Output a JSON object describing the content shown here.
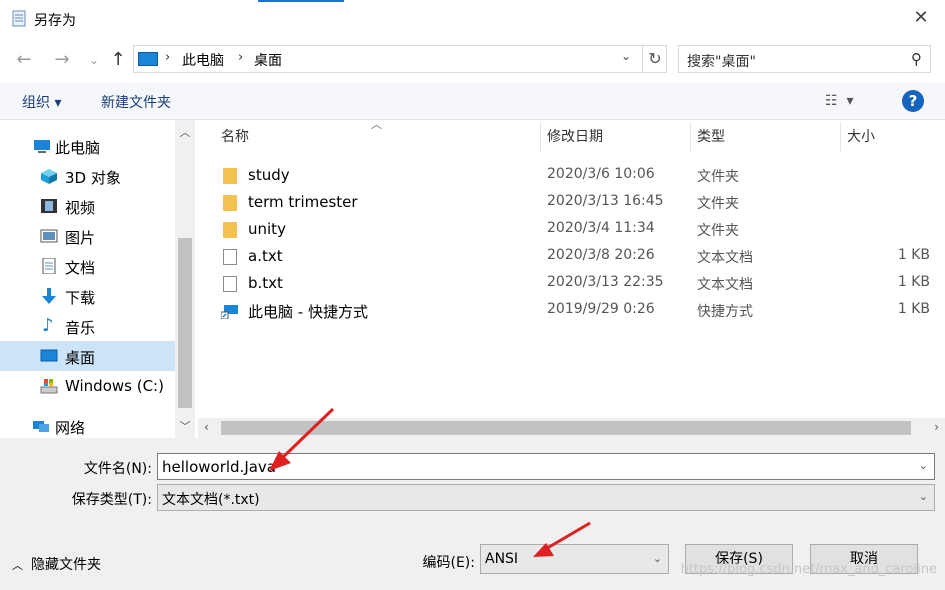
{
  "window": {
    "title": "另存为",
    "close_label": "✕"
  },
  "nav": {
    "back_icon": "←",
    "forward_icon": "→",
    "recent_icon": "⌄",
    "up_icon": "↑",
    "breadcrumb": [
      "此电脑",
      "桌面"
    ],
    "search_placeholder": "搜索\"桌面\""
  },
  "toolbar": {
    "organize": "组织 ▾",
    "new_folder": "新建文件夹",
    "help": "?"
  },
  "sidebar": {
    "items": [
      {
        "label": "此电脑",
        "icon": "computer-icon"
      },
      {
        "label": "3D 对象",
        "icon": "cube-icon"
      },
      {
        "label": "视频",
        "icon": "video-icon"
      },
      {
        "label": "图片",
        "icon": "picture-icon"
      },
      {
        "label": "文档",
        "icon": "document-icon"
      },
      {
        "label": "下载",
        "icon": "download-icon"
      },
      {
        "label": "音乐",
        "icon": "music-icon"
      },
      {
        "label": "桌面",
        "icon": "desktop-icon",
        "selected": true
      },
      {
        "label": "Windows (C:)",
        "icon": "drive-icon"
      },
      {
        "label": "网络",
        "icon": "network-icon"
      }
    ]
  },
  "list": {
    "columns": [
      "名称",
      "修改日期",
      "类型",
      "大小"
    ],
    "rows": [
      {
        "name": "study",
        "date": "2020/3/6 10:06",
        "type": "文件夹",
        "size": "",
        "icon": "folder-icon"
      },
      {
        "name": "term trimester",
        "date": "2020/3/13 16:45",
        "type": "文件夹",
        "size": "",
        "icon": "folder-icon"
      },
      {
        "name": "unity",
        "date": "2020/3/4 11:34",
        "type": "文件夹",
        "size": "",
        "icon": "folder-icon"
      },
      {
        "name": "a.txt",
        "date": "2020/3/8 20:26",
        "type": "文本文档",
        "size": "1 KB",
        "icon": "text-file-icon"
      },
      {
        "name": "b.txt",
        "date": "2020/3/13 22:35",
        "type": "文本文档",
        "size": "1 KB",
        "icon": "text-file-icon"
      },
      {
        "name": "此电脑 - 快捷方式",
        "date": "2019/9/29 0:26",
        "type": "快捷方式",
        "size": "1 KB",
        "icon": "shortcut-icon"
      }
    ]
  },
  "form": {
    "filename_label": "文件名(N):",
    "filename_value": "helloworld.Java",
    "filetype_label": "保存类型(T):",
    "filetype_value": "文本文档(*.txt)",
    "encoding_label": "编码(E):",
    "encoding_value": "ANSI",
    "save_label": "保存(S)",
    "cancel_label": "取消",
    "hide_folders_label": "隐藏文件夹"
  },
  "watermark": "https://blog.csdn.net/max_and_caroline",
  "colors": {
    "accent": "#1565c0",
    "selection": "#cce4f7",
    "annotation_arrow": "#e02020"
  }
}
